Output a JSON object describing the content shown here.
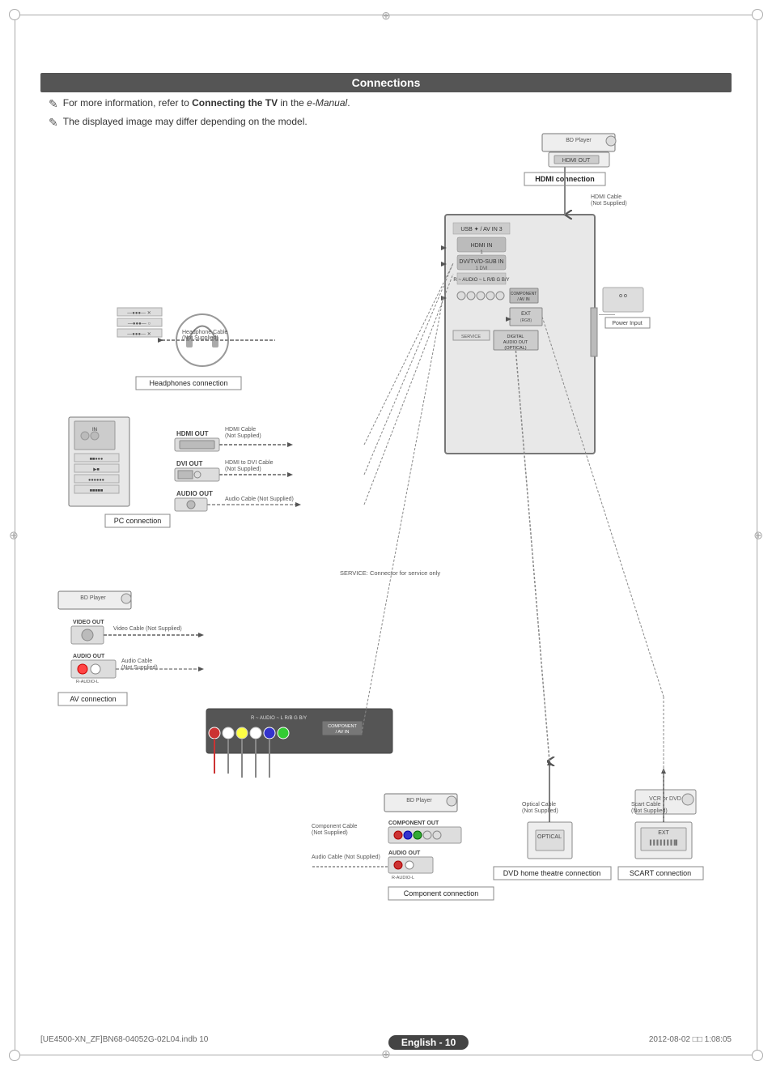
{
  "page": {
    "title": "Connections",
    "footer_left": "[UE4500-XN_ZF]BN68-04052G-02L04.indb   10",
    "footer_center": "English - 10",
    "footer_right": "2012-08-02   □□  1:08:05"
  },
  "info_bullets": [
    {
      "id": 1,
      "text_normal": "For more information, refer to ",
      "text_bold": "Connecting the TV",
      "text_normal2": " in the ",
      "text_italic": "e-Manual",
      "text_end": "."
    },
    {
      "id": 2,
      "text_normal": "The displayed image may differ depending on the model."
    }
  ],
  "connections": [
    {
      "id": "hdmi",
      "label": "HDMI connection"
    },
    {
      "id": "headphones",
      "label": "Headphones connection"
    },
    {
      "id": "pc",
      "label": "PC connection"
    },
    {
      "id": "av",
      "label": "AV connection"
    },
    {
      "id": "component",
      "label": "Component connection"
    },
    {
      "id": "dvd",
      "label": "DVD home theatre connection"
    },
    {
      "id": "scart",
      "label": "SCART connection"
    }
  ],
  "cables": [
    {
      "id": "hdmi_cable",
      "label": "HDMI Cable\n(Not Supplied)"
    },
    {
      "id": "headphone_cable",
      "label": "Headphone Cable\n(Not Supplied)"
    },
    {
      "id": "hdmi_cable2",
      "label": "HDMI Cable\n(Not Supplied)"
    },
    {
      "id": "hdmi_dvi_cable",
      "label": "HDMI to DVI Cable\n(Not Supplied)"
    },
    {
      "id": "audio_cable",
      "label": "Audio Cable (Not Supplied)"
    },
    {
      "id": "video_cable",
      "label": "Video Cable (Not Supplied)"
    },
    {
      "id": "audio_cable2",
      "label": "Audio Cable\n(Not Supplied)"
    },
    {
      "id": "component_cable",
      "label": "Component Cable\n(Not Supplied)"
    },
    {
      "id": "audio_cable3",
      "label": "Audio Cable (Not Supplied)"
    },
    {
      "id": "optical_cable",
      "label": "Optical Cable\n(Not Supplied)"
    },
    {
      "id": "scart_cable",
      "label": "Scart Cable\n(Not Supplied)"
    }
  ],
  "ports": [
    {
      "id": "hdmi_out",
      "label": "HDMI OUT"
    },
    {
      "id": "dvi_out",
      "label": "DVI OUT"
    },
    {
      "id": "audio_out",
      "label": "AUDIO OUT"
    },
    {
      "id": "video_out",
      "label": "VIDEO OUT"
    },
    {
      "id": "audio_out2",
      "label": "AUDIO OUT"
    },
    {
      "id": "component_out",
      "label": "COMPONENT OUT"
    },
    {
      "id": "audio_out3",
      "label": "AUDIO OUT"
    },
    {
      "id": "optical",
      "label": "OPTICAL"
    },
    {
      "id": "ext",
      "label": "EXT"
    }
  ],
  "devices": [
    {
      "id": "bd_player_top",
      "label": "BD Player"
    },
    {
      "id": "bd_player_left",
      "label": "BD Player"
    },
    {
      "id": "bd_player_bottom",
      "label": "BD Player"
    },
    {
      "id": "pc",
      "label": "PC"
    },
    {
      "id": "vcr_dvd",
      "label": "VCR or DVD"
    }
  ],
  "service_note": "SERVICE: Connector for service only",
  "power_input": "Power Input"
}
